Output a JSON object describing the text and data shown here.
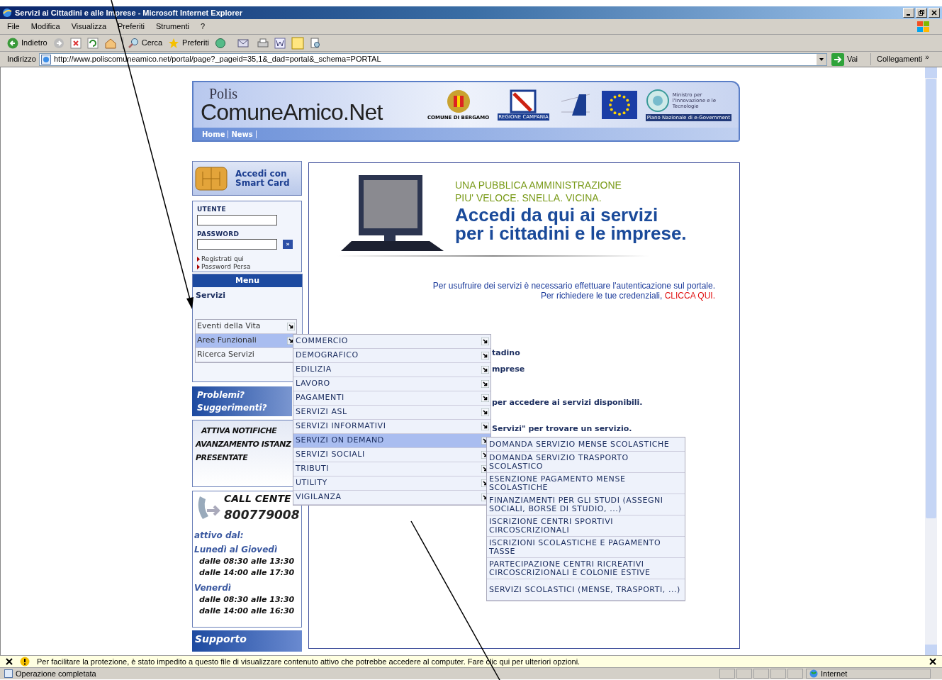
{
  "window": {
    "title": "Servizi ai Cittadini e alle Imprese - Microsoft Internet Explorer"
  },
  "menubar": [
    "File",
    "Modifica",
    "Visualizza",
    "Preferiti",
    "Strumenti",
    "?"
  ],
  "toolbar": {
    "back": "Indietro",
    "search": "Cerca",
    "favorites": "Preferiti"
  },
  "address": {
    "label": "Indirizzo",
    "url": "http://www.poliscomuneamico.net/portal/page?_pageid=35,1&_dad=portal&_schema=PORTAL",
    "go": "Vai",
    "links": "Collegamenti",
    "links_more": "»"
  },
  "banner": {
    "logo_small": "Polis",
    "logo": "ComuneAmico.Net",
    "bergamo": "COMUNE DI BERGAMO",
    "campania": "REGIONE CAMPANIA",
    "ministry": "Ministro per l'Innovazione e le Tecnologie",
    "egov": "Piano Nazionale di e-Government",
    "nav": [
      "Home",
      "News"
    ]
  },
  "smartcard": {
    "label": "Accedi con Smart Card"
  },
  "login": {
    "user_label": "UTENTE",
    "password_label": "PASSWORD",
    "submit": "»",
    "links": [
      "Registrati qui",
      "Password Persa"
    ]
  },
  "menu": {
    "title": "Menu",
    "section": "Servizi",
    "items": [
      {
        "label": "Eventi della Vita",
        "selected": false
      },
      {
        "label": "Aree Funzionali",
        "selected": true
      },
      {
        "label": "Ricerca Servizi",
        "selected": false
      }
    ]
  },
  "submenu": [
    {
      "label": "COMMERCIO",
      "selected": false
    },
    {
      "label": "DEMOGRAFICO",
      "selected": false
    },
    {
      "label": "EDILIZIA",
      "selected": false
    },
    {
      "label": "LAVORO",
      "selected": false
    },
    {
      "label": "PAGAMENTI",
      "selected": false
    },
    {
      "label": "SERVIZI ASL",
      "selected": false
    },
    {
      "label": "SERVIZI INFORMATIVI",
      "selected": false
    },
    {
      "label": "SERVIZI ON DEMAND",
      "selected": true
    },
    {
      "label": "SERVIZI SOCIALI",
      "selected": false
    },
    {
      "label": "TRIBUTI",
      "selected": false
    },
    {
      "label": "UTILITY",
      "selected": false
    },
    {
      "label": "VIGILANZA",
      "selected": false
    }
  ],
  "subsubmenu": [
    "DOMANDA SERVIZIO MENSE SCOLASTICHE",
    "DOMANDA SERVIZIO TRASPORTO SCOLASTICO",
    "ESENZIONE PAGAMENTO MENSE SCOLASTICHE",
    "FINANZIAMENTI PER GLI STUDI (ASSEGNI SOCIALI, BORSE DI STUDIO, ...)",
    "ISCRIZIONE CENTRI SPORTIVI CIRCOSCRIZIONALI",
    "ISCRIZIONI SCOLASTICHE E PAGAMENTO TASSE",
    "PARTECIPAZIONE CENTRI RICREATIVI CIRCOSCRIZIONALI E COLONIE ESTIVE",
    "SERVIZI SCOLASTICI (MENSE, TRASPORTI, ...)"
  ],
  "promo": {
    "line_1": "Problemi?",
    "line_2": "Suggerimenti?"
  },
  "notifications": [
    "ATTIVA NOTIFICHE",
    "AVANZAMENTO ISTANZ",
    "PRESENTATE"
  ],
  "call_center": {
    "title": "CALL CENTE",
    "number": "800779008",
    "active": "attivo dal:",
    "groups": [
      {
        "days": "Lunedì al Giovedì",
        "hours": [
          "dalle 08:30 alle 13:30",
          "dalle 14:00 alle 17:30"
        ]
      },
      {
        "days": "Venerdì",
        "hours": [
          "dalle 08:30 alle 13:30",
          "dalle 14:00 alle 16:30"
        ]
      }
    ]
  },
  "support": "Supporto",
  "hero": {
    "tagline_1": "UNA PUBBLICA AMMINISTRAZIONE",
    "tagline_2": "PIU' VELOCE. SNELLA. VICINA.",
    "headline_1": "Accedi da qui ai servizi",
    "headline_2": "per i cittadini e le imprese."
  },
  "notice": {
    "line_1": "Per usufruire dei servizi è necessario effettuare l'autenticazione sul portale.",
    "line_2": "Per richiedere le tue credenziali,",
    "link": "CLICCA QUI."
  },
  "fragments": [
    "tadino",
    "mprese",
    "per accedere ai servizi disponibili.",
    "Servizi\" per trovare un servizio."
  ],
  "infobar": "Per facilitare la protezione, è stato impedito a questo file di visualizzare contenuto attivo che potrebbe accedere al computer. Fare clic qui per ulteriori opzioni.",
  "status_bar": {
    "text": "Operazione completata",
    "zone": "Internet"
  }
}
